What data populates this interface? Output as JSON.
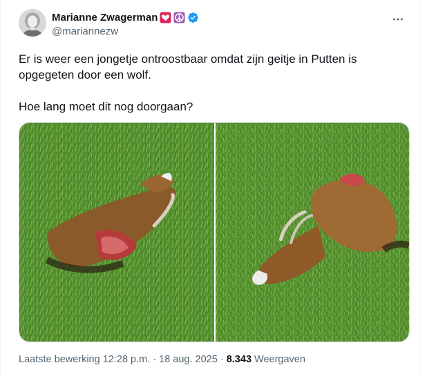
{
  "author": {
    "display_name": "Marianne Zwagerman",
    "handle": "@mariannezw",
    "badges": [
      "heart-emoji",
      "peace-sign-emoji",
      "verified-badge"
    ]
  },
  "tweet": {
    "paragraphs": [
      "Er is weer een jongetje ontroostbaar omdat zijn geitje in Putten is opgegeten door een wolf.",
      "Hoe lang moet dit nog doorgaan?"
    ]
  },
  "media": {
    "photos": [
      {
        "icon": "goat-carcass-photo-left"
      },
      {
        "icon": "goat-carcass-photo-right"
      }
    ]
  },
  "meta": {
    "edited_prefix": "Laatste bewerking",
    "time": "12:28 p.m.",
    "separator": "·",
    "date": "18 aug. 2025",
    "views_count": "8.343",
    "views_label": "Weergaven"
  },
  "colors": {
    "text_primary": "#0f1419",
    "text_secondary": "#536471",
    "verified_blue": "#1d9bf0",
    "heart_red": "#e0245e",
    "peace_purple": "#9b59b6",
    "grass_green": "#4f8a2b"
  }
}
